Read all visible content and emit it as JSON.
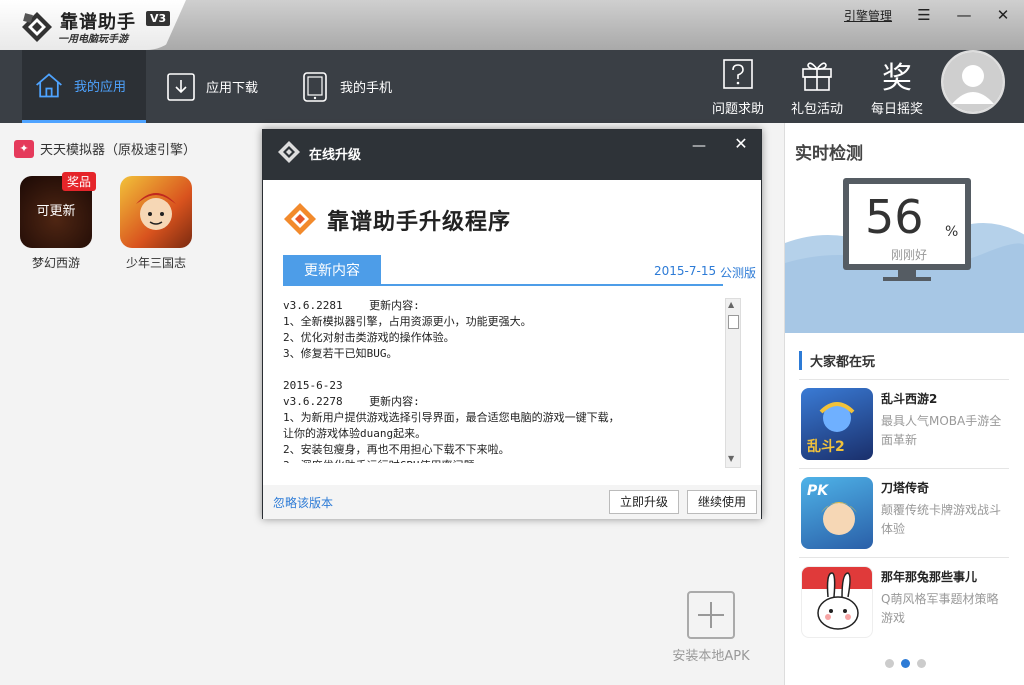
{
  "app": {
    "title": "靠谱助手",
    "version_badge": "V3",
    "subtitle": "一用电脑玩手游"
  },
  "titlebar": {
    "engine_link": "引擎管理",
    "menu_icon": "menu-icon",
    "minimize_icon": "minimize-icon",
    "close_icon": "close-icon"
  },
  "nav": {
    "tabs": [
      {
        "label": "我的应用",
        "icon": "home-icon",
        "active": true
      },
      {
        "label": "应用下载",
        "icon": "download-icon"
      },
      {
        "label": "我的手机",
        "icon": "phone-icon"
      }
    ],
    "right_buttons": [
      {
        "label": "问题求助",
        "icon": "help-icon"
      },
      {
        "label": "礼包活动",
        "icon": "gift-icon"
      },
      {
        "label": "每日摇奖",
        "icon": "lottery-icon",
        "glyph": "奖"
      }
    ]
  },
  "emulator": {
    "badge": "✦",
    "label": "天天模拟器（原极速引擎）"
  },
  "apps": [
    {
      "name": "梦幻西游",
      "overlay": "可更新",
      "tag": "奖品"
    },
    {
      "name": "少年三国志"
    }
  ],
  "install_apk": {
    "label": "安装本地APK"
  },
  "realtime": {
    "title": "实时检测",
    "value": "56",
    "unit": "%",
    "status": "刚刚好"
  },
  "popular": {
    "title": "大家都在玩",
    "games": [
      {
        "name": "乱斗西游2",
        "desc": "最具人气MOBA手游全面革新",
        "icon_text": "乱斗2"
      },
      {
        "name": "刀塔传奇",
        "desc": "颠覆传统卡牌游戏战斗体验",
        "icon_text": "PK"
      },
      {
        "name": "那年那兔那些事儿",
        "desc": "Q萌风格军事题材策略游戏",
        "icon_text": ""
      }
    ],
    "page_count": 3,
    "active_page": 2
  },
  "dialog": {
    "title": "在线升级",
    "heading": "靠谱助手升级程序",
    "tab_label": "更新内容",
    "date": "2015-7-15",
    "version_link": "公测版",
    "notes": "v3.6.2281    更新内容:\n1、全新模拟器引擎，占用资源更小，功能更强大。\n2、优化对射击类游戏的操作体验。\n3、修复若干已知BUG。\n\n2015-6-23\nv3.6.2278    更新内容:\n1、为新用户提供游戏选择引导界面，最合适您电脑的游戏一键下载，\n让你的游戏体验duang起来。\n2、安装包瘦身，再也不用担心下载不下来啦。\n3、深度优化助手运行时CPU使用率问题。",
    "ignore_link": "忽略该版本",
    "upgrade_button": "立即升级",
    "continue_button": "继续使用",
    "minimize_icon": "minimize-icon",
    "close_icon": "close-icon"
  },
  "colors": {
    "accent": "#4d9de8",
    "nav_bg": "#3a3f45",
    "badge_red": "#e5252a",
    "link": "#2d7bd6"
  }
}
